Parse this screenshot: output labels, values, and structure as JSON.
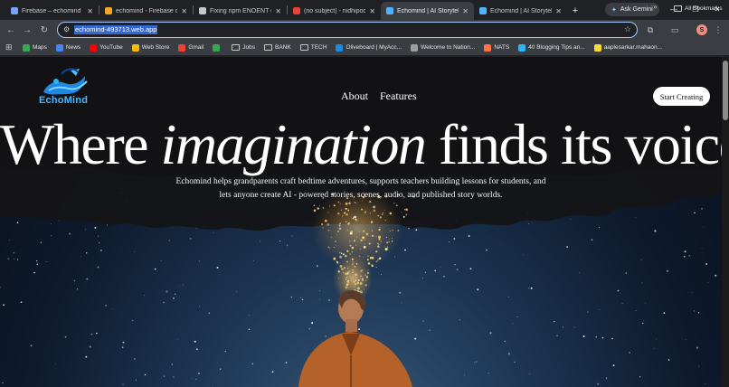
{
  "browser": {
    "tabs": [
      {
        "title": "Firebase – echomind",
        "color": "#7aa2f7",
        "active": false
      },
      {
        "title": "echomind - Firebase co",
        "color": "#f6a623",
        "active": false
      },
      {
        "title": "Fixing npm ENOENT er",
        "color": "#c4c7c5",
        "active": false
      },
      {
        "title": "(no subject) - nidhipoo",
        "color": "#ea4335",
        "active": false
      },
      {
        "title": "Echomind | AI Storytel",
        "color": "#4fb4ff",
        "active": true
      },
      {
        "title": "Echomind | AI Storytel",
        "color": "#4fb4ff",
        "active": false
      }
    ],
    "new_tab": "+",
    "close_glyph": "✕",
    "gemini_label": "Ask Gemini",
    "url": "echomind-493713.web.app",
    "profile_initial": "S",
    "bookmarks": [
      {
        "label": "Maps",
        "kind": "icon",
        "color": "#34a853"
      },
      {
        "label": "News",
        "kind": "icon",
        "color": "#4285f4"
      },
      {
        "label": "YouTube",
        "kind": "icon",
        "color": "#ff0000"
      },
      {
        "label": "Web Store",
        "kind": "icon",
        "color": "#fbbc05"
      },
      {
        "label": "Gmail",
        "kind": "icon",
        "color": "#ea4335"
      },
      {
        "label": "",
        "kind": "icon",
        "color": "#34a853"
      },
      {
        "label": "Jobs",
        "kind": "folder"
      },
      {
        "label": "BANK",
        "kind": "folder"
      },
      {
        "label": "TECH",
        "kind": "folder"
      },
      {
        "label": "Oliveboard | MyAcc...",
        "kind": "icon",
        "color": "#1e88e5"
      },
      {
        "label": "Welcome to Nation...",
        "kind": "icon",
        "color": "#9e9e9e"
      },
      {
        "label": "NATS",
        "kind": "icon",
        "color": "#ff7043"
      },
      {
        "label": "40 Blogging Tips an...",
        "kind": "icon",
        "color": "#29b6f6"
      },
      {
        "label": "aaplesarkar.mahaon...",
        "kind": "icon",
        "color": "#fdd835"
      }
    ],
    "more_glyph": "»",
    "all_bookmarks": "All Bookmarks"
  },
  "site": {
    "logo_text": "EchoMind",
    "nav": [
      {
        "label": "About"
      },
      {
        "label": "Features"
      }
    ],
    "cta": "Start Creating",
    "headline": {
      "part1": "Where ",
      "italic": "imagination",
      "part2": " finds its voice."
    },
    "subtitle_line1": "Echomind helps grandparents craft bedtime adventures, supports teachers building lessons for students, and",
    "subtitle_line2": "lets anyone create AI - powered stories, scenes, audio, and published story worlds."
  },
  "colors": {
    "brand_blue": "#4fb4ff",
    "accent_url_highlight": "#3367d6"
  }
}
